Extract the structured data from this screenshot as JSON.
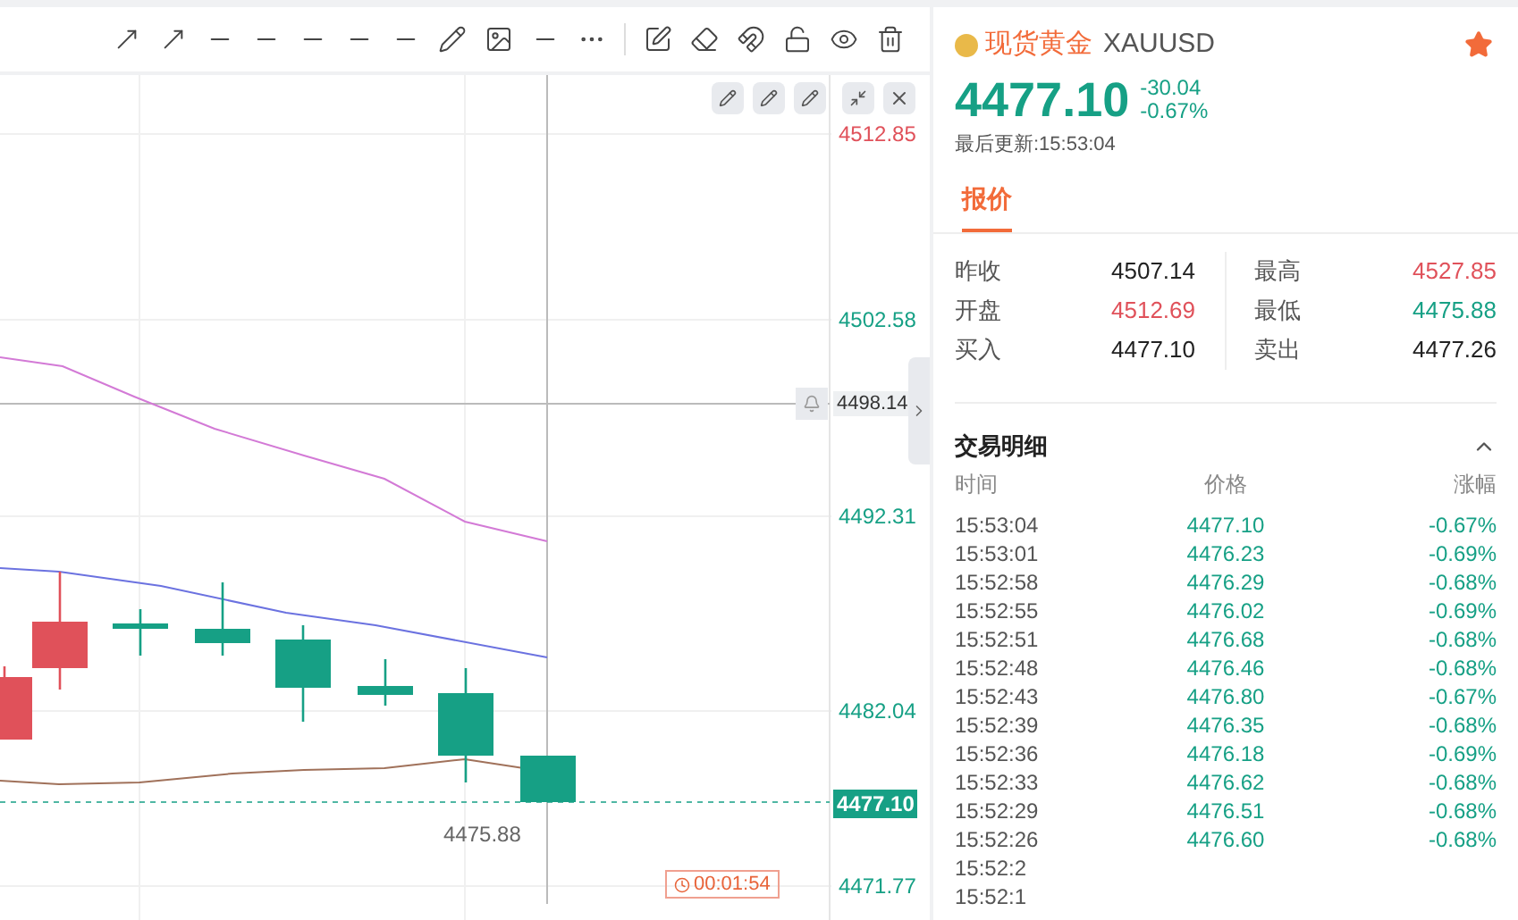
{
  "chart": {
    "price_labels": [
      {
        "text": "4512.85",
        "kind": "up"
      },
      {
        "text": "4502.58",
        "kind": "down"
      },
      {
        "text": "4492.31",
        "kind": "down"
      },
      {
        "text": "4482.04",
        "kind": "down"
      },
      {
        "text": "4471.77",
        "kind": "down"
      }
    ],
    "crosshair_price": "4498.14",
    "current_price": "4477.10",
    "low_label": "4475.88",
    "countdown": "00:01:54"
  },
  "quote": {
    "name": "现货黄金",
    "symbol": "XAUUSD",
    "favorite": true,
    "price": "4477.10",
    "change": "-30.04",
    "change_pct": "-0.67%",
    "updated": "最后更新:15:53:04"
  },
  "tabs": [
    {
      "label": "报价",
      "selected": true
    }
  ],
  "stats": [
    {
      "label": "昨收",
      "value": "4507.14",
      "kind": "neutral"
    },
    {
      "label": "最高",
      "value": "4527.85",
      "kind": "up"
    },
    {
      "label": "开盘",
      "value": "4512.69",
      "kind": "up"
    },
    {
      "label": "最低",
      "value": "4475.88",
      "kind": "down"
    },
    {
      "label": "买入",
      "value": "4477.10",
      "kind": "neutral"
    },
    {
      "label": "卖出",
      "value": "4477.26",
      "kind": "neutral"
    }
  ],
  "trades": {
    "title": "交易明细",
    "expanded": true,
    "columns": [
      "时间",
      "价格",
      "涨幅"
    ],
    "rows": [
      {
        "time": "15:53:04",
        "price": "4477.10",
        "change": "-0.67%"
      },
      {
        "time": "15:53:01",
        "price": "4476.23",
        "change": "-0.69%"
      },
      {
        "time": "15:52:58",
        "price": "4476.29",
        "change": "-0.68%"
      },
      {
        "time": "15:52:55",
        "price": "4476.02",
        "change": "-0.69%"
      },
      {
        "time": "15:52:51",
        "price": "4476.68",
        "change": "-0.68%"
      },
      {
        "time": "15:52:48",
        "price": "4476.46",
        "change": "-0.68%"
      },
      {
        "time": "15:52:43",
        "price": "4476.80",
        "change": "-0.67%"
      },
      {
        "time": "15:52:39",
        "price": "4476.35",
        "change": "-0.68%"
      },
      {
        "time": "15:52:36",
        "price": "4476.18",
        "change": "-0.69%"
      },
      {
        "time": "15:52:33",
        "price": "4476.62",
        "change": "-0.68%"
      },
      {
        "time": "15:52:29",
        "price": "4476.51",
        "change": "-0.68%"
      },
      {
        "time": "15:52:26",
        "price": "4476.60",
        "change": "-0.68%"
      },
      {
        "time": "15:52:2"
      },
      {
        "time": "15:52:1"
      }
    ]
  }
}
